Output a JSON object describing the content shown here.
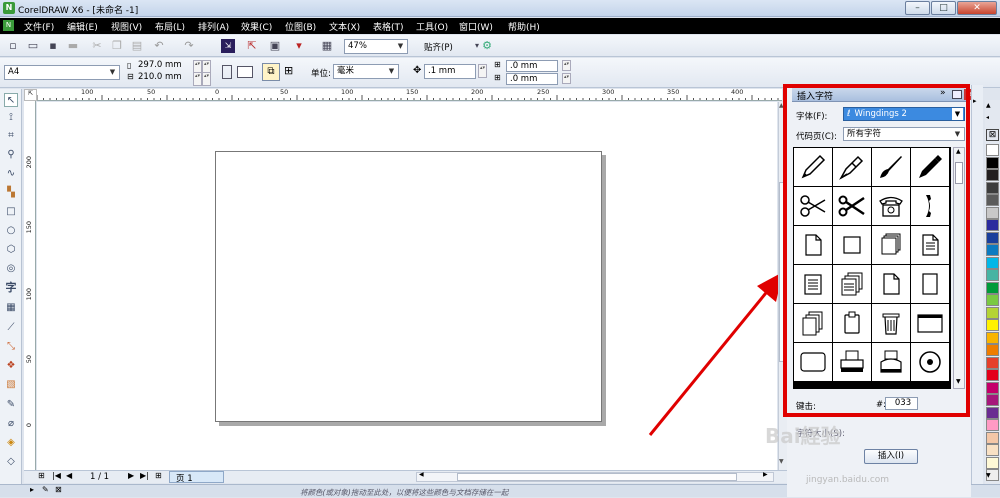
{
  "window": {
    "title": "CorelDRAW X6 - [未命名 -1]",
    "logo": "coreldraw-logo",
    "controls": [
      "minimize",
      "maximize",
      "close"
    ]
  },
  "menubar": {
    "items": [
      "文件(F)",
      "编辑(E)",
      "视图(V)",
      "布局(L)",
      "排列(A)",
      "效果(C)",
      "位图(B)",
      "文本(X)",
      "表格(T)",
      "工具(O)",
      "窗口(W)",
      "帮助(H)"
    ]
  },
  "toolbar": {
    "zoom": "47%",
    "snap_label": "贴齐(P)"
  },
  "propertybar": {
    "page_size": "A4",
    "width": "297.0 mm",
    "height": "210.0 mm",
    "unit_label": "单位:",
    "unit_value": "毫米",
    "nudge": ".1 mm",
    "dup_x": ".0 mm",
    "dup_y": ".0 mm"
  },
  "rulers": {
    "h_ticks": [
      "100",
      "50",
      "0",
      "50",
      "100",
      "150",
      "200",
      "250",
      "300",
      "350",
      "400"
    ],
    "v_ticks": [
      "200",
      "150",
      "100",
      "50",
      "0"
    ]
  },
  "page_nav": {
    "page_count": "1 / 1",
    "page_tab": "页 1"
  },
  "statusbar": {
    "hint": "将颜色(或对象)拖动至此处，以便将这些颜色与文档存储在一起"
  },
  "docker": {
    "title": "插入字符",
    "font_label": "字体(F):",
    "font_value": "Wingdings 2",
    "codepage_label": "代码页(C):",
    "codepage_value": "所有字符",
    "keystroke_label": "键击:",
    "keystroke_prefix": "#:",
    "keystroke_value": "033",
    "size_label": "字符大小(S):",
    "insert_button": "插入(I)",
    "glyphs": [
      "pen-icon",
      "fountain-pen-icon",
      "brush-icon",
      "marker-icon",
      "scissors-open-icon",
      "scissors-icon",
      "telephone-icon",
      "handset-icon",
      "page-icon",
      "blank-page-icon",
      "stacked-pages-icon",
      "text-page-icon",
      "lined-page-icon",
      "multi-page-icon",
      "folded-page-icon",
      "portrait-page-icon",
      "copies-icon",
      "clipboard-icon",
      "trash-can-icon",
      "window-icon",
      "rounded-rect-icon",
      "printer-icon",
      "phone-icon",
      "bullseye-icon"
    ]
  },
  "colors": {
    "highlight": "#e00000",
    "menubar": "#000000",
    "palette": [
      "#ffffff",
      "#000000",
      "#231f20",
      "#3d3d3d",
      "#5b5b5b",
      "#c8c8c8",
      "#2b2b9e",
      "#1a3f9c",
      "#0b7bc1",
      "#00b7e8",
      "#46b4a3",
      "#009b3a",
      "#7ac943",
      "#b4d335",
      "#fff200",
      "#f8b400",
      "#ef7d00",
      "#e53f2a",
      "#e3001b",
      "#c4006a",
      "#a6177b",
      "#6a2c91",
      "#ff9ac4",
      "#f4c7a7",
      "#f9e1c4",
      "#fff9d6",
      "#eeeeee"
    ]
  },
  "watermark": {
    "text": "Bai経验",
    "url": "jingyan.baidu.com"
  }
}
